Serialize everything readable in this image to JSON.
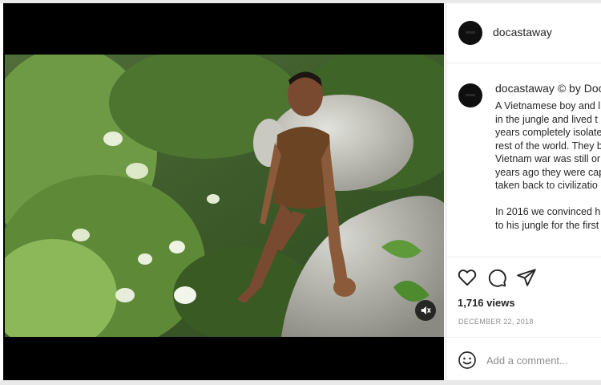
{
  "post": {
    "username": "docastaway",
    "caption": {
      "username": "docastaway",
      "credit": "© by Doca",
      "lines": [
        "A Vietnamese boy and l",
        "in the jungle and lived t",
        "years completely isolate",
        "rest of the world. They b",
        "Vietnam war was still or",
        "years ago they were cap",
        "taken back to civilizatio",
        "",
        "In 2016 we convinced h",
        "to his jungle for the first"
      ]
    },
    "views": "1,716 views",
    "date": "DECEMBER 22, 2018",
    "comment_placeholder": "Add a comment..."
  },
  "icons": {
    "like": "heart-icon",
    "comment": "comment-icon",
    "share": "share-icon",
    "mute": "speaker-muted-icon",
    "emoji": "emoji-icon"
  },
  "colors": {
    "text": "#262626",
    "muted": "#8e8e8e",
    "divider": "#efefef",
    "video_background": "#000000"
  }
}
